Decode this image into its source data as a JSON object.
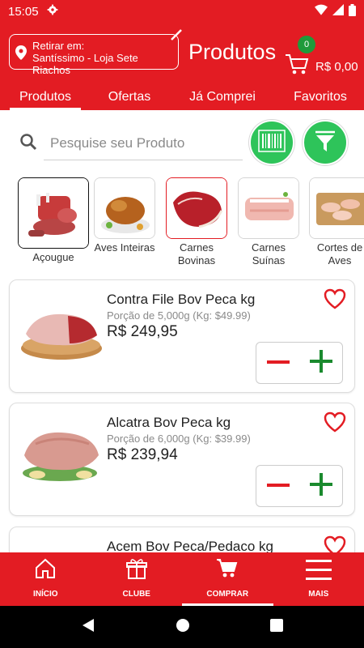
{
  "status_bar": {
    "time": "15:05"
  },
  "header": {
    "store_label": "Retirar em:",
    "store_name": "Santíssimo - Loja Sete Riachos",
    "title": "Produtos",
    "cart_count": "0",
    "cart_total": "R$ 0,00"
  },
  "tabs": [
    {
      "label": "Produtos",
      "active": true
    },
    {
      "label": "Ofertas"
    },
    {
      "label": "Já Comprei"
    },
    {
      "label": "Favoritos"
    }
  ],
  "search": {
    "placeholder": "Pesquise seu Produto"
  },
  "categories": [
    {
      "label": "Açougue"
    },
    {
      "label": "Aves Inteiras"
    },
    {
      "label": "Carnes Bovinas"
    },
    {
      "label": "Carnes Suínas"
    },
    {
      "label": "Cortes de Aves"
    }
  ],
  "products": [
    {
      "name": "Contra File Bov Peca kg",
      "portion": "Porção de 5,000g (Kg: $49.99)",
      "price": "R$ 249,95"
    },
    {
      "name": "Alcatra Bov Peca kg",
      "portion": "Porção de 6,000g (Kg: $39.99)",
      "price": "R$ 239,94"
    },
    {
      "name": "Acem Bov Peca/Pedaco kg"
    }
  ],
  "bottom_nav": [
    {
      "label": "INÍCIO",
      "icon": "home-icon"
    },
    {
      "label": "CLUBE",
      "icon": "gift-icon"
    },
    {
      "label": "COMPRAR",
      "icon": "cart-icon",
      "active": true
    },
    {
      "label": "MAIS",
      "icon": "menu-icon"
    }
  ],
  "colors": {
    "primary": "#e31c23",
    "accent_green": "#2ec45a",
    "plus_green": "#1a8a2e"
  }
}
